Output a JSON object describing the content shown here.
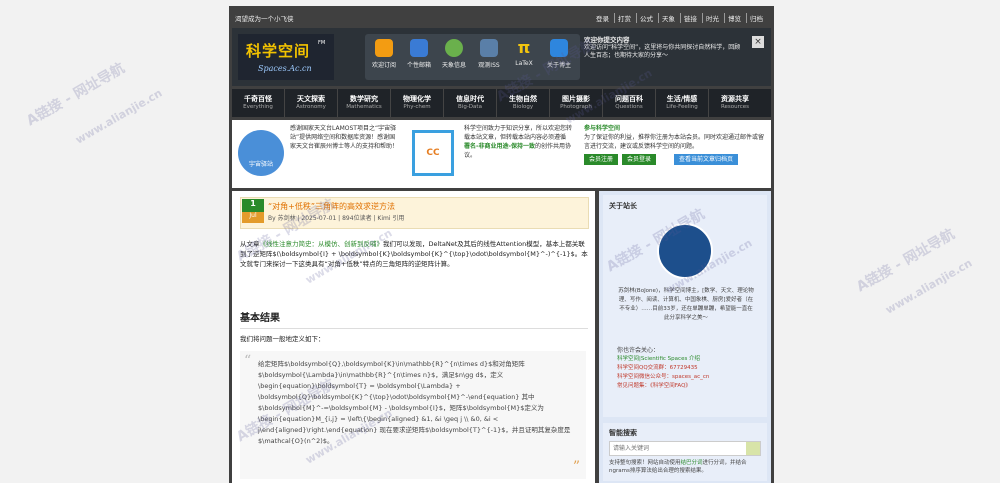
{
  "topbar": {
    "tagline": "渴望成为一个小飞侠",
    "links": [
      "登录",
      "打赏",
      "公式",
      "天象",
      "链接",
      "时光",
      "博览",
      "归档"
    ]
  },
  "logo": {
    "title": "科学空间",
    "subtitle": "Spaces.Ac.cn",
    "badge": "FM"
  },
  "header_icons": [
    {
      "label": "欢迎订阅",
      "icon": "rss-icon",
      "color": "#f39c12"
    },
    {
      "label": "个性邮箱",
      "icon": "mail-icon",
      "color": "#3a7bd5"
    },
    {
      "label": "天象信息",
      "icon": "planet-icon",
      "color": "#6ab04c"
    },
    {
      "label": "观测ISS",
      "icon": "satellite-icon",
      "color": "#5a7fa8"
    },
    {
      "label": "LaTeX",
      "icon": "pi-icon",
      "color": "#f1c40f"
    },
    {
      "label": "关于博主",
      "icon": "about-icon",
      "color": "#2e86de"
    }
  ],
  "welcome": {
    "heading": "欢迎你提交内容",
    "text": "欢迎访问“科学空间”，这里将与你共同探讨自然科学，回顾人生百态；也期待大家的分享～"
  },
  "nav": [
    {
      "zh": "千奇百怪",
      "en": "Everything"
    },
    {
      "zh": "天文探索",
      "en": "Astronomy"
    },
    {
      "zh": "数学研究",
      "en": "Mathematics"
    },
    {
      "zh": "物理化学",
      "en": "Phy-chem"
    },
    {
      "zh": "信息时代",
      "en": "Big-Data"
    },
    {
      "zh": "生物自然",
      "en": "Biology"
    },
    {
      "zh": "图片摄影",
      "en": "Photograph"
    },
    {
      "zh": "问题百科",
      "en": "Questions"
    },
    {
      "zh": "生活/情感",
      "en": "Life-Feeling"
    },
    {
      "zh": "资源共享",
      "en": "Resources"
    }
  ],
  "ads": {
    "ad1_text": "感谢国家天文台LAMOST项目之“宇宙驿站”提供网络空间和数据库资源！感谢国家天文台崔辰州博士等人的支持和帮助！",
    "ad1_logo": "宇宙驿站",
    "ad2_text": "科学空间致力于知识分享，所以欢迎您转载本站文章，但转载本站内容必须遵循",
    "ad2_link": "署名-非商业用途-保持一致",
    "ad2_tail": "的创作共用协议。",
    "ad3_title": "参与科学空间",
    "ad3_text": "为了保证你的利益，推荐你注册为本站会员。同时欢迎通过邮件或留言进行交流，建议或反馈科学空间的问题。",
    "btn_register": "会员注册",
    "btn_login": "会员登录",
    "btn_rss": "查看当前文章归档页"
  },
  "post": {
    "day": "1",
    "month": "Jul",
    "title": "“对角+低秩”三角阵的高效求逆方法",
    "meta": "By 苏剑林 | 2025-07-01 | 894位读者 | Kimi 引用",
    "intro_a": "从文章",
    "intro_link": "《线性注意力简史：从模仿、创新到反哺》",
    "intro_b": "我们可以发现，DeltaNet及其后的线性Attention模型，基本上都关联到了逆矩阵$(\\boldsymbol{I} + \\boldsymbol{K}\\boldsymbol{K}^{\\top}\\odot\\boldsymbol{M}^-)^{-1}$。本文就专门来探讨一下这类具有“对角+低秩”特点的三角矩阵的逆矩阵计算。",
    "section": "基本结果",
    "def_line": "我们将问题一般地定义如下：",
    "quote": "给定矩阵$\\boldsymbol{Q},\\boldsymbol{K}\\in\\mathbb{R}^{n\\times d}$和对角矩阵$\\boldsymbol{\\Lambda}\\in\\mathbb{R}^{n\\times n}$，满足$n\\gg d$，定义 \\begin{equation}\\boldsymbol{T} = \\boldsymbol{\\Lambda} + \\boldsymbol{Q}\\boldsymbol{K}^{\\top}\\odot\\boldsymbol{M}^-\\end{equation} 其中$\\boldsymbol{M}^-=\\boldsymbol{M} - \\boldsymbol{I}$，矩阵$\\boldsymbol{M}$定义为 \\begin{equation}M_{i,j} = \\left\\{\\begin{aligned} &1, &i \\geq j \\\\ &0, &i < j\\end{aligned}\\right.\\end{equation} 现在要求逆矩阵$\\boldsymbol{T}^{-1}$，并且证明其复杂度是$\\mathcal{O}(n^2)$。"
  },
  "sidebar": {
    "about_title": "关于站长",
    "about_text": "苏剑林(BoJone)，科学空间博主，[数学、天文、理论物理、写作、阅读、计算机、中国象棋、厨房]爱好者（在不专业）……目前33岁，还在单蹦单蹦，希望能一直在此分享科学之美～",
    "links_title": "你也许会关心：",
    "links": [
      "科学空间|Scientific Spaces 介绍",
      "科学空间QQ交流群：67729435",
      "科学空间微信公众号：spaces_ac_cn",
      "常见问题集：《科学空间FAQ》"
    ],
    "search_title": "智能搜索",
    "search_placeholder": "请输入关键词",
    "search_note_a": "支持整句搜索！网站自动使用",
    "search_note_link": "结巴分词",
    "search_note_b": "进行分词，并结合ngrams排序算法给出合理的搜索结果。"
  },
  "watermark": "A链接 - 网址导航",
  "watermark_url": "www.alianjie.cn"
}
